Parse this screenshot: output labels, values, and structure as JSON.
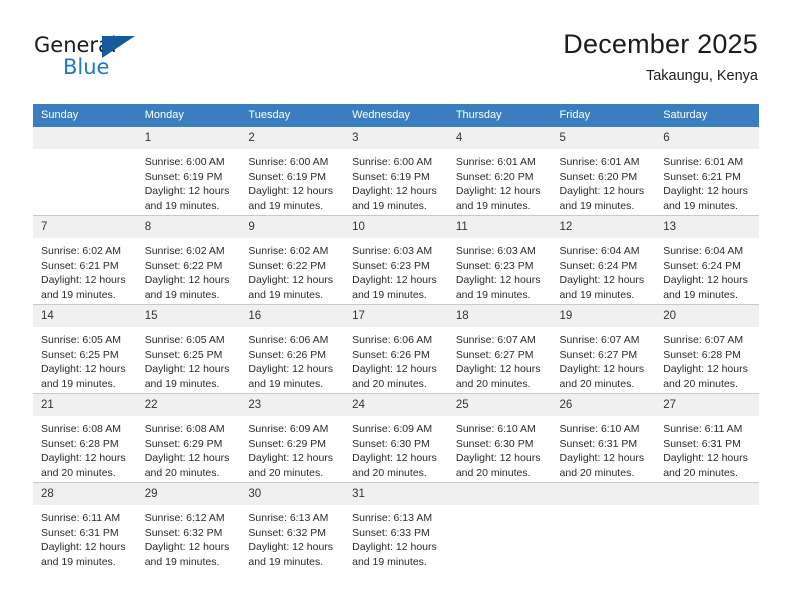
{
  "logo": {
    "word_one": "General",
    "word_two": "Blue",
    "triangle_color": "#155a9c",
    "blue_color": "#2079c7"
  },
  "header": {
    "title": "December 2025",
    "subtitle": "Takaungu, Kenya"
  },
  "calendar": {
    "header_background": "#3a7ebf",
    "daynum_background": "#f0f0f0",
    "weekday_headers": [
      "Sunday",
      "Monday",
      "Tuesday",
      "Wednesday",
      "Thursday",
      "Friday",
      "Saturday"
    ],
    "labels": {
      "sunrise": "Sunrise:",
      "sunset": "Sunset:",
      "daylight": "Daylight:"
    },
    "weeks": [
      [
        {
          "day": "",
          "sunrise": "",
          "sunset": "",
          "daylight": "",
          "empty": true
        },
        {
          "day": "1",
          "sunrise": "Sunrise: 6:00 AM",
          "sunset": "Sunset: 6:19 PM",
          "daylight": "Daylight: 12 hours and 19 minutes."
        },
        {
          "day": "2",
          "sunrise": "Sunrise: 6:00 AM",
          "sunset": "Sunset: 6:19 PM",
          "daylight": "Daylight: 12 hours and 19 minutes."
        },
        {
          "day": "3",
          "sunrise": "Sunrise: 6:00 AM",
          "sunset": "Sunset: 6:19 PM",
          "daylight": "Daylight: 12 hours and 19 minutes."
        },
        {
          "day": "4",
          "sunrise": "Sunrise: 6:01 AM",
          "sunset": "Sunset: 6:20 PM",
          "daylight": "Daylight: 12 hours and 19 minutes."
        },
        {
          "day": "5",
          "sunrise": "Sunrise: 6:01 AM",
          "sunset": "Sunset: 6:20 PM",
          "daylight": "Daylight: 12 hours and 19 minutes."
        },
        {
          "day": "6",
          "sunrise": "Sunrise: 6:01 AM",
          "sunset": "Sunset: 6:21 PM",
          "daylight": "Daylight: 12 hours and 19 minutes."
        }
      ],
      [
        {
          "day": "7",
          "sunrise": "Sunrise: 6:02 AM",
          "sunset": "Sunset: 6:21 PM",
          "daylight": "Daylight: 12 hours and 19 minutes."
        },
        {
          "day": "8",
          "sunrise": "Sunrise: 6:02 AM",
          "sunset": "Sunset: 6:22 PM",
          "daylight": "Daylight: 12 hours and 19 minutes."
        },
        {
          "day": "9",
          "sunrise": "Sunrise: 6:02 AM",
          "sunset": "Sunset: 6:22 PM",
          "daylight": "Daylight: 12 hours and 19 minutes."
        },
        {
          "day": "10",
          "sunrise": "Sunrise: 6:03 AM",
          "sunset": "Sunset: 6:23 PM",
          "daylight": "Daylight: 12 hours and 19 minutes."
        },
        {
          "day": "11",
          "sunrise": "Sunrise: 6:03 AM",
          "sunset": "Sunset: 6:23 PM",
          "daylight": "Daylight: 12 hours and 19 minutes."
        },
        {
          "day": "12",
          "sunrise": "Sunrise: 6:04 AM",
          "sunset": "Sunset: 6:24 PM",
          "daylight": "Daylight: 12 hours and 19 minutes."
        },
        {
          "day": "13",
          "sunrise": "Sunrise: 6:04 AM",
          "sunset": "Sunset: 6:24 PM",
          "daylight": "Daylight: 12 hours and 19 minutes."
        }
      ],
      [
        {
          "day": "14",
          "sunrise": "Sunrise: 6:05 AM",
          "sunset": "Sunset: 6:25 PM",
          "daylight": "Daylight: 12 hours and 19 minutes."
        },
        {
          "day": "15",
          "sunrise": "Sunrise: 6:05 AM",
          "sunset": "Sunset: 6:25 PM",
          "daylight": "Daylight: 12 hours and 19 minutes."
        },
        {
          "day": "16",
          "sunrise": "Sunrise: 6:06 AM",
          "sunset": "Sunset: 6:26 PM",
          "daylight": "Daylight: 12 hours and 19 minutes."
        },
        {
          "day": "17",
          "sunrise": "Sunrise: 6:06 AM",
          "sunset": "Sunset: 6:26 PM",
          "daylight": "Daylight: 12 hours and 20 minutes."
        },
        {
          "day": "18",
          "sunrise": "Sunrise: 6:07 AM",
          "sunset": "Sunset: 6:27 PM",
          "daylight": "Daylight: 12 hours and 20 minutes."
        },
        {
          "day": "19",
          "sunrise": "Sunrise: 6:07 AM",
          "sunset": "Sunset: 6:27 PM",
          "daylight": "Daylight: 12 hours and 20 minutes."
        },
        {
          "day": "20",
          "sunrise": "Sunrise: 6:07 AM",
          "sunset": "Sunset: 6:28 PM",
          "daylight": "Daylight: 12 hours and 20 minutes."
        }
      ],
      [
        {
          "day": "21",
          "sunrise": "Sunrise: 6:08 AM",
          "sunset": "Sunset: 6:28 PM",
          "daylight": "Daylight: 12 hours and 20 minutes."
        },
        {
          "day": "22",
          "sunrise": "Sunrise: 6:08 AM",
          "sunset": "Sunset: 6:29 PM",
          "daylight": "Daylight: 12 hours and 20 minutes."
        },
        {
          "day": "23",
          "sunrise": "Sunrise: 6:09 AM",
          "sunset": "Sunset: 6:29 PM",
          "daylight": "Daylight: 12 hours and 20 minutes."
        },
        {
          "day": "24",
          "sunrise": "Sunrise: 6:09 AM",
          "sunset": "Sunset: 6:30 PM",
          "daylight": "Daylight: 12 hours and 20 minutes."
        },
        {
          "day": "25",
          "sunrise": "Sunrise: 6:10 AM",
          "sunset": "Sunset: 6:30 PM",
          "daylight": "Daylight: 12 hours and 20 minutes."
        },
        {
          "day": "26",
          "sunrise": "Sunrise: 6:10 AM",
          "sunset": "Sunset: 6:31 PM",
          "daylight": "Daylight: 12 hours and 20 minutes."
        },
        {
          "day": "27",
          "sunrise": "Sunrise: 6:11 AM",
          "sunset": "Sunset: 6:31 PM",
          "daylight": "Daylight: 12 hours and 20 minutes."
        }
      ],
      [
        {
          "day": "28",
          "sunrise": "Sunrise: 6:11 AM",
          "sunset": "Sunset: 6:31 PM",
          "daylight": "Daylight: 12 hours and 19 minutes."
        },
        {
          "day": "29",
          "sunrise": "Sunrise: 6:12 AM",
          "sunset": "Sunset: 6:32 PM",
          "daylight": "Daylight: 12 hours and 19 minutes."
        },
        {
          "day": "30",
          "sunrise": "Sunrise: 6:13 AM",
          "sunset": "Sunset: 6:32 PM",
          "daylight": "Daylight: 12 hours and 19 minutes."
        },
        {
          "day": "31",
          "sunrise": "Sunrise: 6:13 AM",
          "sunset": "Sunset: 6:33 PM",
          "daylight": "Daylight: 12 hours and 19 minutes."
        },
        {
          "day": "",
          "sunrise": "",
          "sunset": "",
          "daylight": "",
          "empty": true
        },
        {
          "day": "",
          "sunrise": "",
          "sunset": "",
          "daylight": "",
          "empty": true
        },
        {
          "day": "",
          "sunrise": "",
          "sunset": "",
          "daylight": "",
          "empty": true
        }
      ]
    ]
  }
}
